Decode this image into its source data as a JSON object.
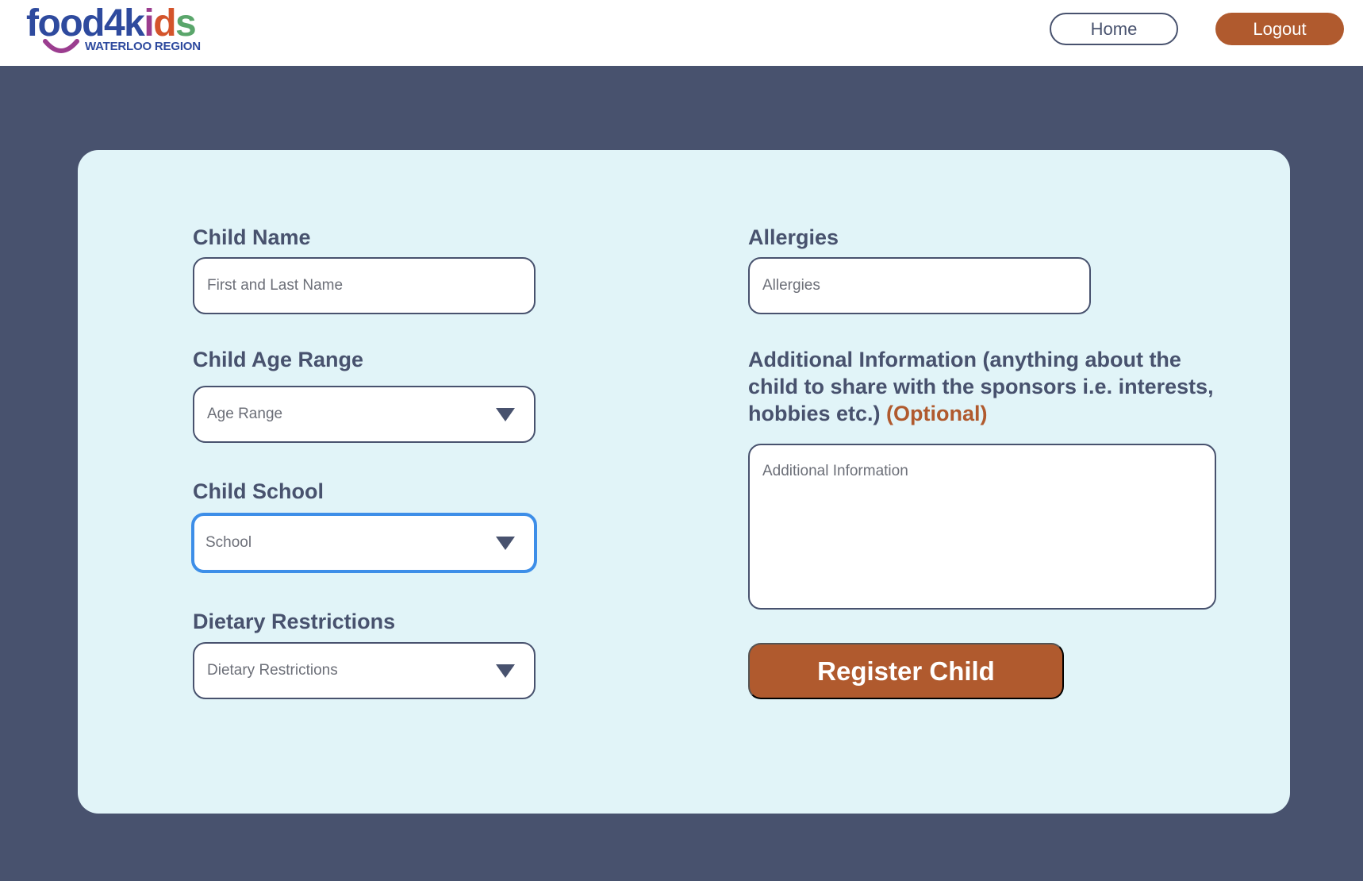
{
  "header": {
    "logo": {
      "letters": [
        {
          "char": "f",
          "color": "#2e4a9e"
        },
        {
          "char": "o",
          "color": "#2e4a9e"
        },
        {
          "char": "o",
          "color": "#2e4a9e"
        },
        {
          "char": "d",
          "color": "#2e4a9e"
        },
        {
          "char": "4",
          "color": "#2e4a9e"
        },
        {
          "char": "k",
          "color": "#2e4a9e"
        },
        {
          "char": "i",
          "color": "#9b3d8f"
        },
        {
          "char": "d",
          "color": "#d4542b"
        },
        {
          "char": "s",
          "color": "#5aa66b"
        }
      ],
      "text": "food4kids",
      "subtitle": "WATERLOO REGION",
      "smile_color": "#9b3d8f"
    },
    "home_label": "Home",
    "logout_label": "Logout"
  },
  "form": {
    "child_name": {
      "label": "Child Name",
      "placeholder": "First and Last Name"
    },
    "age_range": {
      "label": "Child Age Range",
      "placeholder": "Age Range"
    },
    "school": {
      "label": "Child School",
      "placeholder": "School"
    },
    "dietary": {
      "label": "Dietary Restrictions",
      "placeholder": "Dietary Restrictions"
    },
    "allergies": {
      "label": "Allergies",
      "placeholder": "Allergies"
    },
    "additional": {
      "label": "Additional Information (anything about the child to share with the sponsors i.e. interests, hobbies etc.)",
      "optional": "(Optional)",
      "placeholder": "Additional Information"
    },
    "submit_label": "Register Child"
  },
  "colors": {
    "background": "#48526e",
    "card": "#e1f4f8",
    "accent": "#b05a2e",
    "focus": "#3d8ee8",
    "text": "#48526e"
  }
}
